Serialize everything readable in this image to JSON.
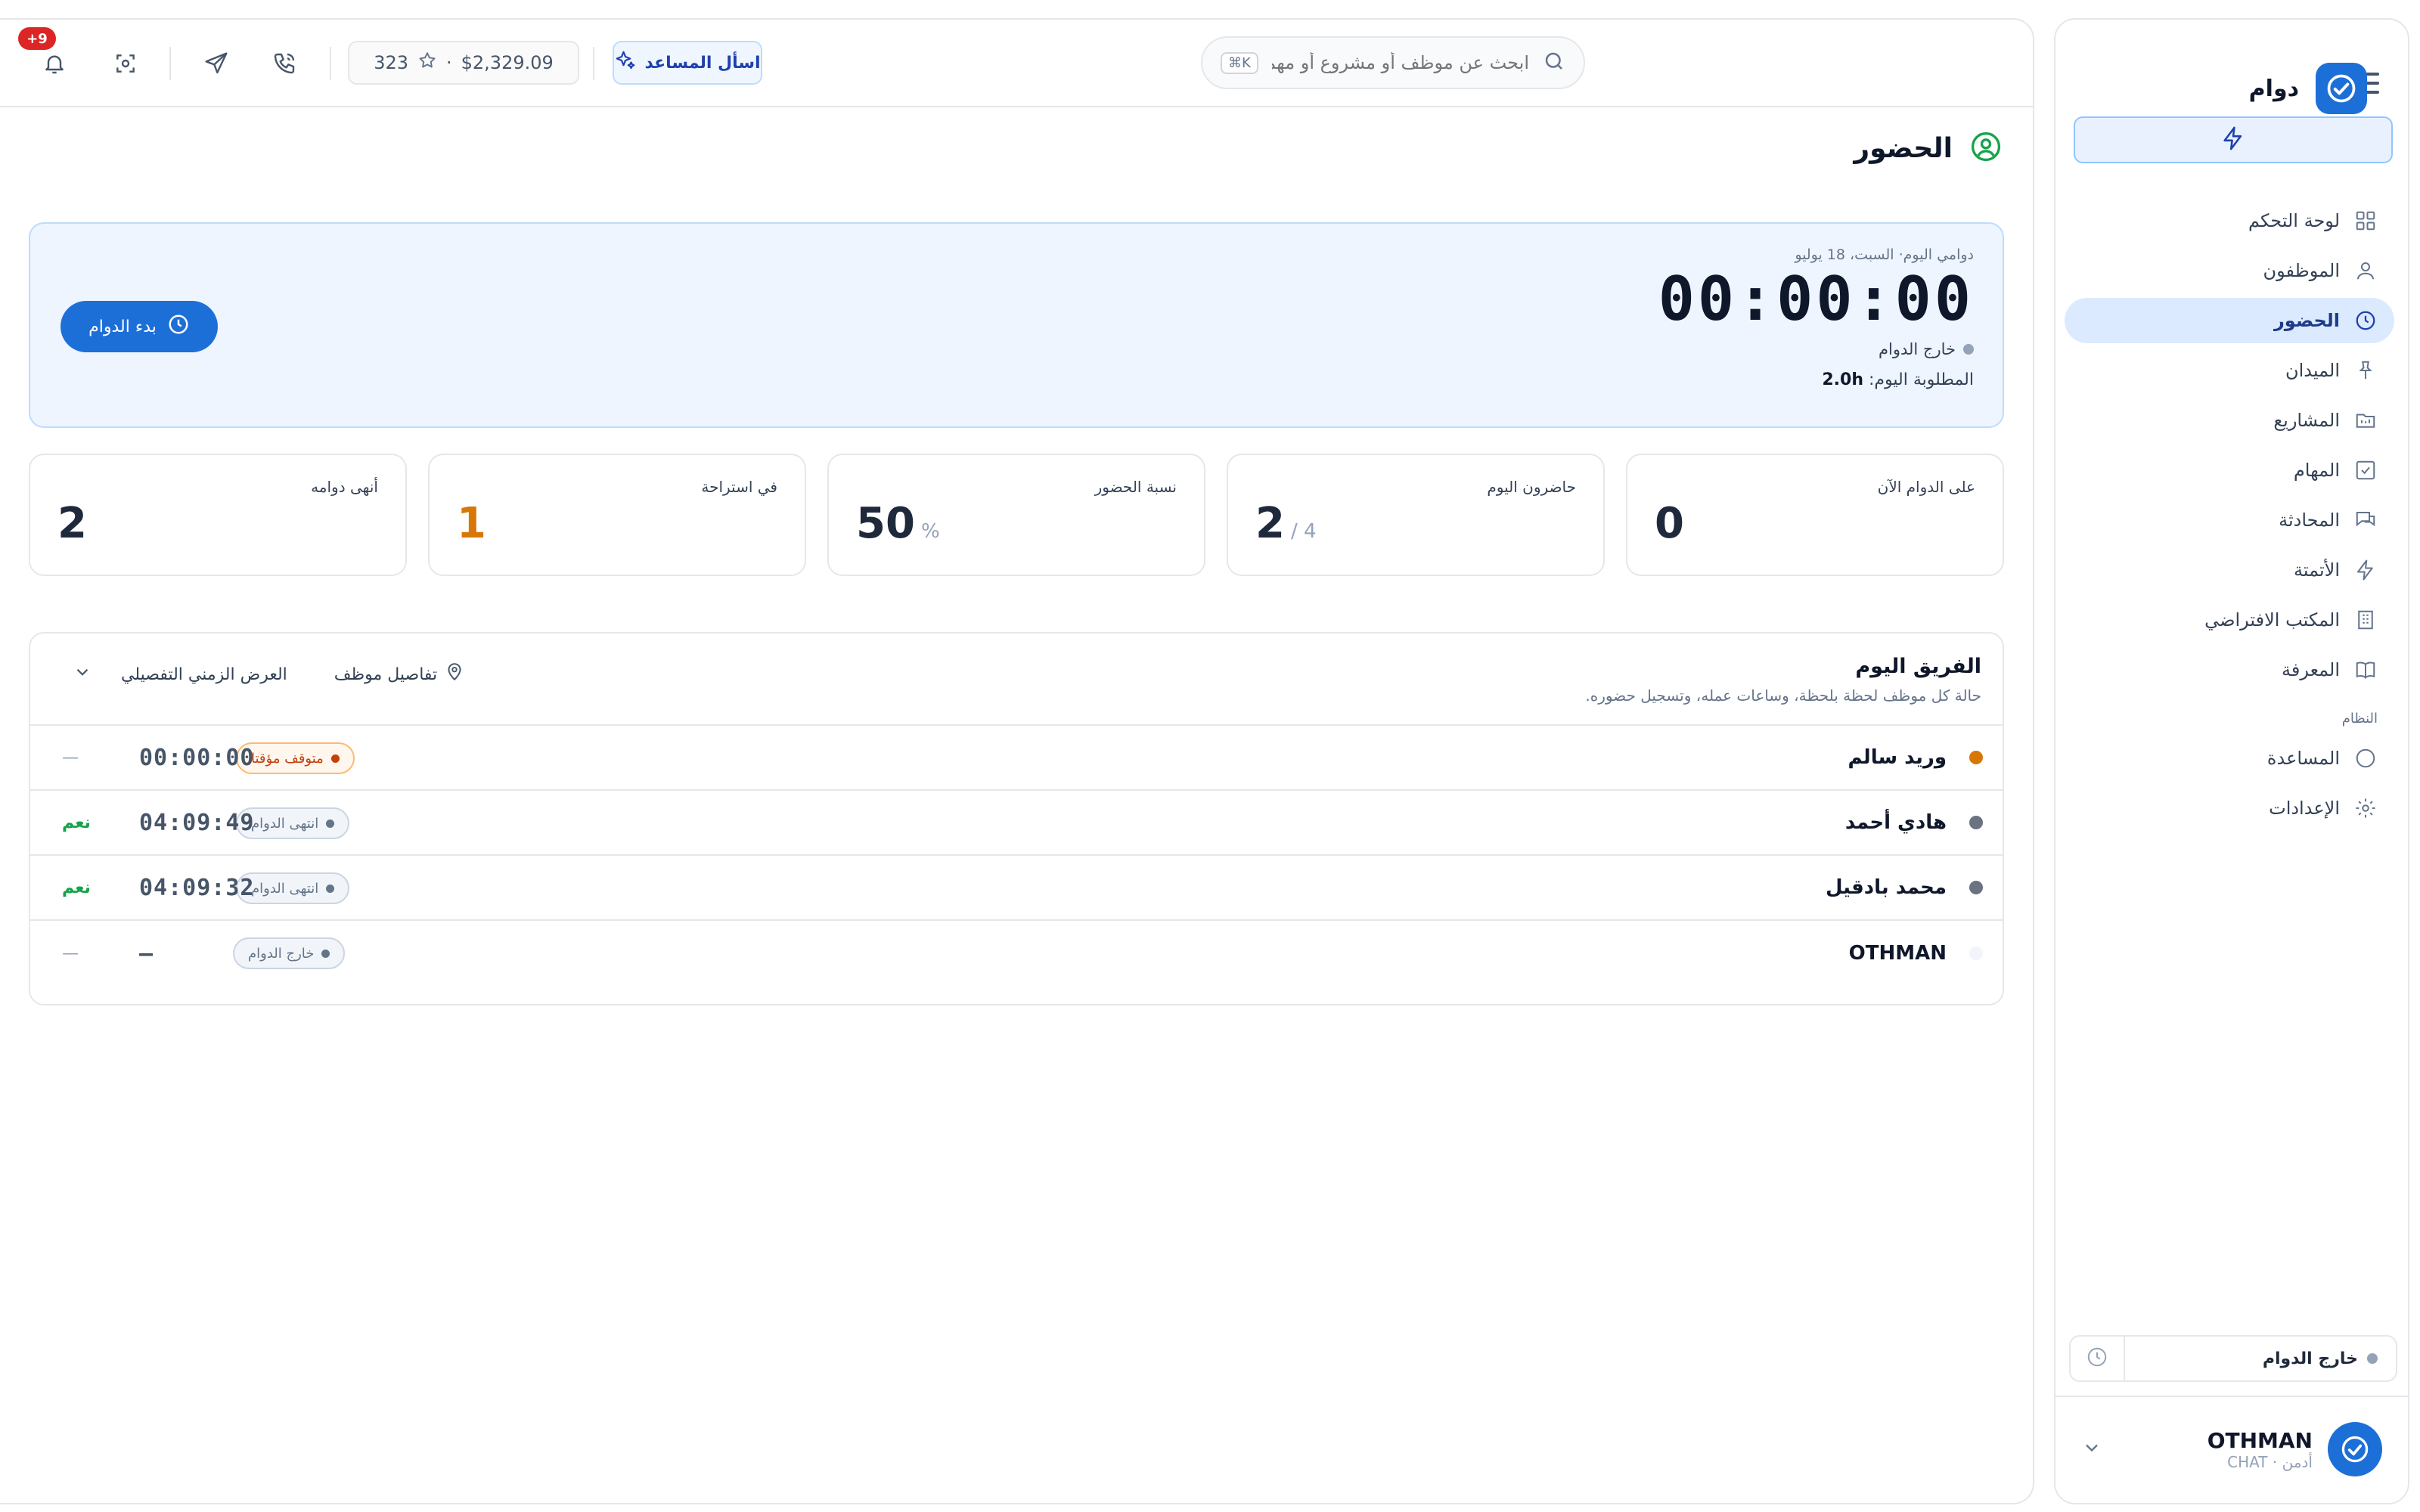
{
  "app": {
    "name": "دوام"
  },
  "sidebar": {
    "items": [
      {
        "label": "لوحة التحكم",
        "icon": "dashboard-icon"
      },
      {
        "label": "الموظفون",
        "icon": "user-icon"
      },
      {
        "label": "الحضور",
        "icon": "clock-icon",
        "active": true
      },
      {
        "label": "الميدان",
        "icon": "pin-icon"
      },
      {
        "label": "المشاريع",
        "icon": "folder-icon"
      },
      {
        "label": "المهام",
        "icon": "checkbox-icon"
      },
      {
        "label": "المحادثة",
        "icon": "chat-icon"
      },
      {
        "label": "الأتمتة",
        "icon": "bolt-icon"
      },
      {
        "label": "المكتب الافتراضي",
        "icon": "building-icon"
      },
      {
        "label": "المعرفة",
        "icon": "book-icon"
      }
    ],
    "system_label": "النظام",
    "system_items": [
      {
        "label": "المساعدة",
        "icon": "help-circle-icon"
      },
      {
        "label": "الإعدادات",
        "icon": "gear-icon"
      }
    ],
    "shift_status": "خارج الدوام",
    "profile": {
      "name": "OTHMAN",
      "subtitle": "أدمن · CHAT"
    }
  },
  "topbar": {
    "search_placeholder": "ابحث عن موظف أو مشروع أو مهمة...",
    "search_shortcut": "⌘K",
    "assistant_label": "اسأل المساعد",
    "wallet_amount": "$2,329.09",
    "wallet_separator": "·",
    "points": "323",
    "notification_count": "+9"
  },
  "page": {
    "title": "الحضور"
  },
  "shift": {
    "date_line": "دوامي اليوم· السبت، 18 يوليو",
    "timer": "00:00:00",
    "state": "خارج الدوام",
    "required_label": "المطلوبة اليوم:",
    "required_value": "2.0h",
    "start_label": "بدء الدوام"
  },
  "stats": [
    {
      "label": "على الدوام الآن",
      "value": "0",
      "sub": ""
    },
    {
      "label": "حاضرون اليوم",
      "value": "2",
      "sub": "/ 4"
    },
    {
      "label": "نسبة الحضور",
      "value": "50",
      "sub": "%"
    },
    {
      "label": "في استراحة",
      "value": "1",
      "sub": "",
      "accent": "#d97706"
    },
    {
      "label": "أنهى دوامه",
      "value": "2",
      "sub": ""
    }
  ],
  "team": {
    "title": "الفريق اليوم",
    "subtitle": "حالة كل موظف لحظة بلحظة، وساعات عمله، وتسجيل حضوره.",
    "details_label": "تفاصيل موظف",
    "timeline_label": "العرض الزمني التفصيلي",
    "rows": [
      {
        "name": "وريد سالم",
        "status": "متوقف مؤقتا",
        "status_type": "paused",
        "dot": "#d97706",
        "time": "00:00:00",
        "mark": "—"
      },
      {
        "name": "هادي أحمد",
        "status": "انتهى الدوام",
        "status_type": "ended",
        "dot": "#6b7280",
        "time": "04:09:49",
        "mark": "نعم"
      },
      {
        "name": "محمد بادقيل",
        "status": "انتهى الدوام",
        "status_type": "ended",
        "dot": "#6b7280",
        "time": "04:09:32",
        "mark": "نعم"
      },
      {
        "name": "OTHMAN",
        "status": "خارج الدوام",
        "status_type": "ended",
        "dot": "#f1f5f9",
        "time": "—",
        "mark": "—"
      }
    ]
  },
  "colors": {
    "accent": "#1d6fd8",
    "accent_soft": "#eef5fe",
    "paused": "#d97706",
    "yes": "#16a34a"
  }
}
